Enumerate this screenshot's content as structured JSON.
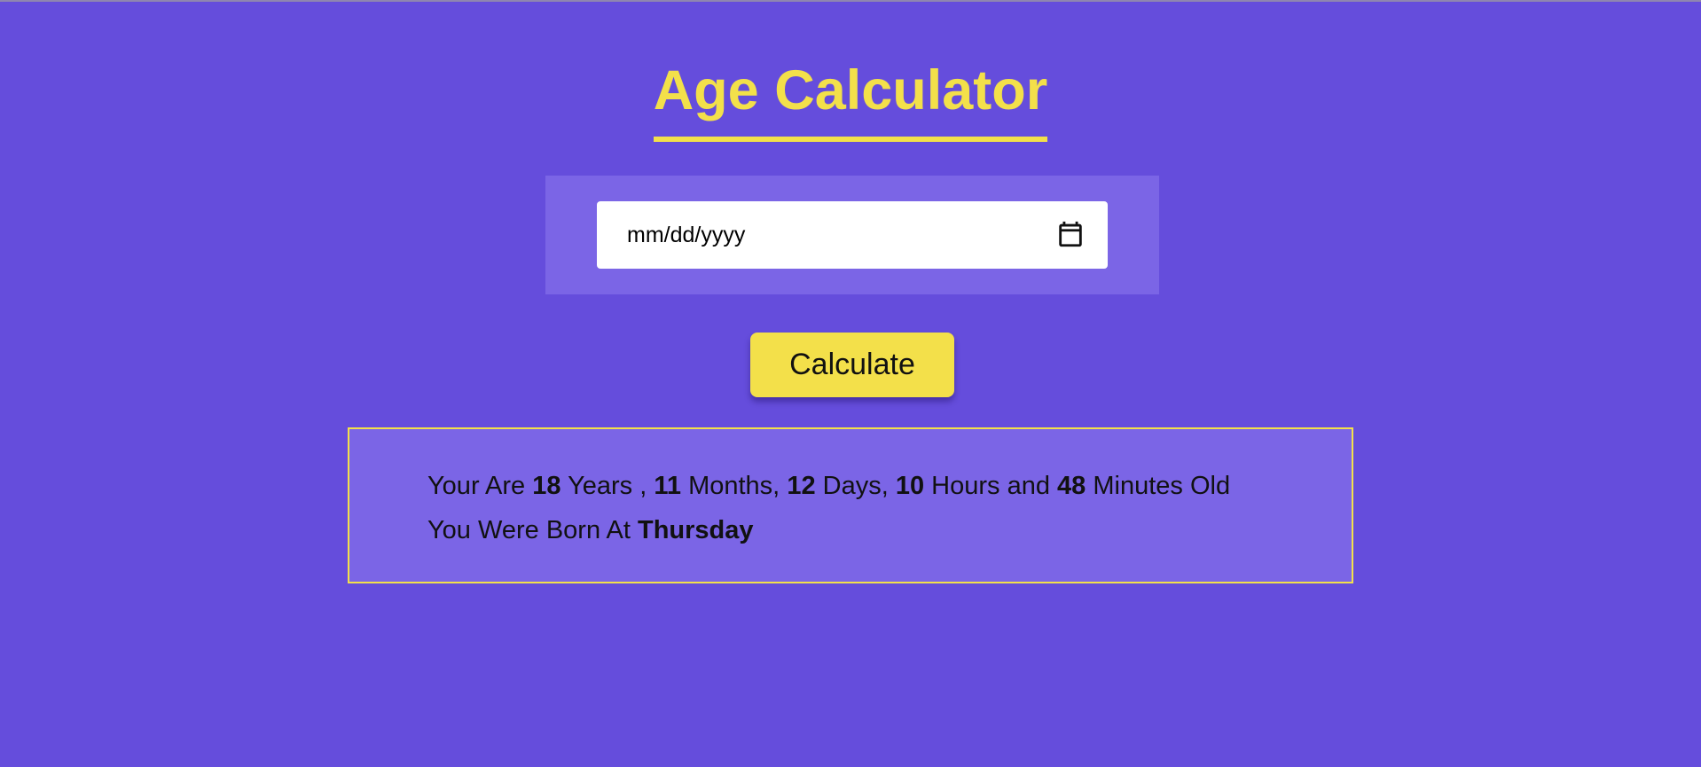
{
  "page": {
    "title": "Age Calculator",
    "colors": {
      "background": "#654ddc",
      "accent": "#f3e04a",
      "panel": "#7b65e6"
    }
  },
  "date_input": {
    "placeholder": "mm/dd/yyyy",
    "icon": "calendar-icon"
  },
  "calculate_button": {
    "label": "Calculate"
  },
  "result": {
    "line1": {
      "prefix": "Your Are",
      "years": "18",
      "years_label": "Years ,",
      "months": "11",
      "months_label": "Months,",
      "days": "12",
      "days_label": "Days,",
      "hours": "10",
      "hours_label": "Hours and",
      "minutes": "48",
      "minutes_label": "Minutes Old"
    },
    "line2": {
      "prefix": "You Were Born At",
      "weekday": "Thursday"
    }
  }
}
